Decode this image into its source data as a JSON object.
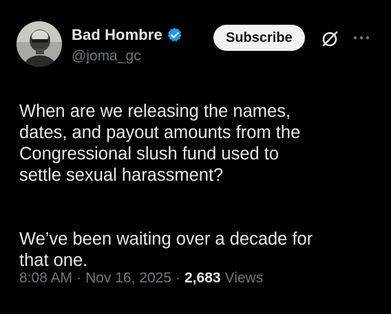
{
  "author": {
    "display_name": "Bad Hombre",
    "handle": "@joma_gc",
    "verified": true
  },
  "actions": {
    "subscribe_label": "Subscribe",
    "grok_icon": "slashed-circle-icon",
    "more_icon": "more-horizontal-icon"
  },
  "tweet": {
    "paragraph_1": "When are we releasing the names,\ndates, and payout amounts from the\nCongressional slush fund used to\nsettle sexual harassment?",
    "paragraph_2": "We’ve been waiting over a decade for\nthat one."
  },
  "meta": {
    "time": "8:08 AM",
    "separator": "·",
    "date": "Nov 16, 2025",
    "views_count": "2,683",
    "views_label": "Views"
  },
  "colors": {
    "background": "#000000",
    "text_primary": "#e7e9ea",
    "text_secondary": "#71767b",
    "verified_blue": "#1d9bf0",
    "button_bg": "#eff3f4",
    "button_text": "#0f1419"
  }
}
